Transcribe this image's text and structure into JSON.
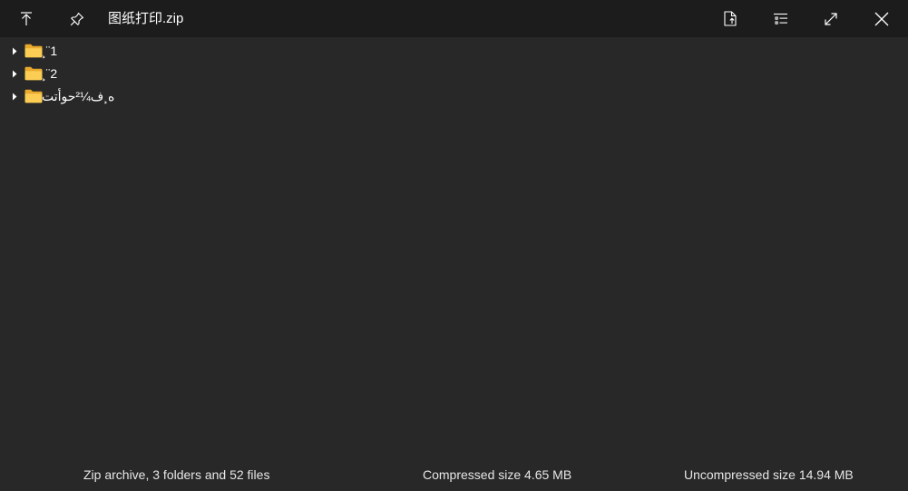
{
  "window": {
    "title": "图纸打印.zip"
  },
  "toolbar": {
    "up_icon": "arrow-up-to-line-icon",
    "pin_icon": "pin-icon",
    "extract_icon": "extract-file-icon",
    "details_icon": "list-view-icon",
    "maximize_icon": "maximize-icon",
    "close_icon": "close-icon"
  },
  "tree": {
    "items": [
      {
        "label": "¸¨1",
        "type": "folder",
        "expanded": false
      },
      {
        "label": "¸¨2",
        "type": "folder",
        "expanded": false
      },
      {
        "label": "ه¸ف¼²حوأتت",
        "type": "folder",
        "expanded": false
      }
    ]
  },
  "status": {
    "summary": "Zip archive, 3 folders and 52 files",
    "compressed": "Compressed size 4.65 MB",
    "uncompressed": "Uncompressed size 14.94 MB"
  },
  "colors": {
    "background": "#282828",
    "titlebar": "#1c1c1c",
    "folder": "#f8c44c",
    "text": "#ffffff"
  }
}
